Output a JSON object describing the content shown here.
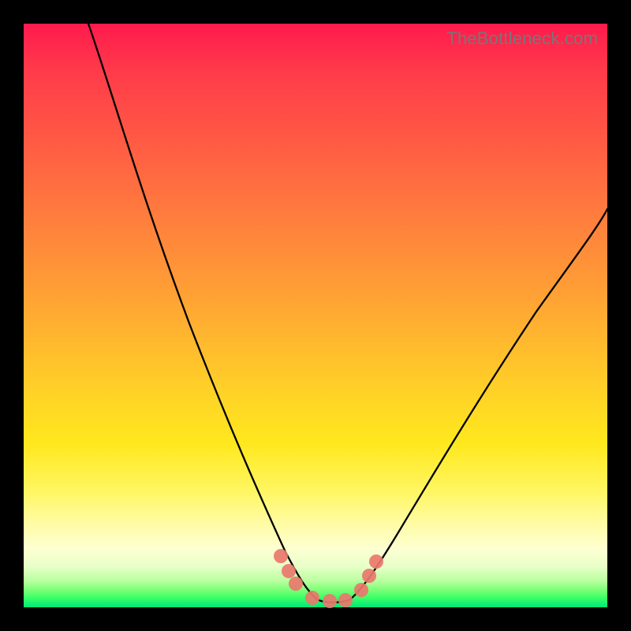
{
  "watermark": "TheBottleneck.com",
  "colors": {
    "frame": "#000000",
    "curve": "#000000",
    "dot": "#e9786d",
    "gradient_top": "#ff1a4d",
    "gradient_bottom": "#00e67a"
  },
  "chart_data": {
    "type": "line",
    "title": "",
    "xlabel": "",
    "ylabel": "",
    "xlim": [
      0,
      100
    ],
    "ylim": [
      0,
      100
    ],
    "series": [
      {
        "name": "left-branch",
        "x": [
          11,
          15,
          20,
          25,
          30,
          34,
          38,
          41,
          43,
          44.5,
          46,
          48,
          50
        ],
        "y": [
          100,
          88,
          74,
          60,
          46,
          34,
          23,
          15,
          10,
          7,
          4,
          2,
          1
        ]
      },
      {
        "name": "flat-valley",
        "x": [
          50,
          52,
          54,
          56
        ],
        "y": [
          1,
          0.8,
          0.8,
          1
        ]
      },
      {
        "name": "right-branch",
        "x": [
          56,
          58,
          61,
          65,
          70,
          76,
          83,
          90,
          97,
          100
        ],
        "y": [
          1,
          4,
          9,
          16,
          25,
          35,
          46,
          56,
          65,
          69
        ]
      }
    ],
    "markers": {
      "name": "highlight-dots",
      "x": [
        43.5,
        45.0,
        46.2,
        49.0,
        52.0,
        55.0,
        57.5,
        58.8,
        60.0
      ],
      "y": [
        8.5,
        6.0,
        4.2,
        1.4,
        1.0,
        1.2,
        3.0,
        5.5,
        8.0
      ]
    },
    "annotations": []
  }
}
